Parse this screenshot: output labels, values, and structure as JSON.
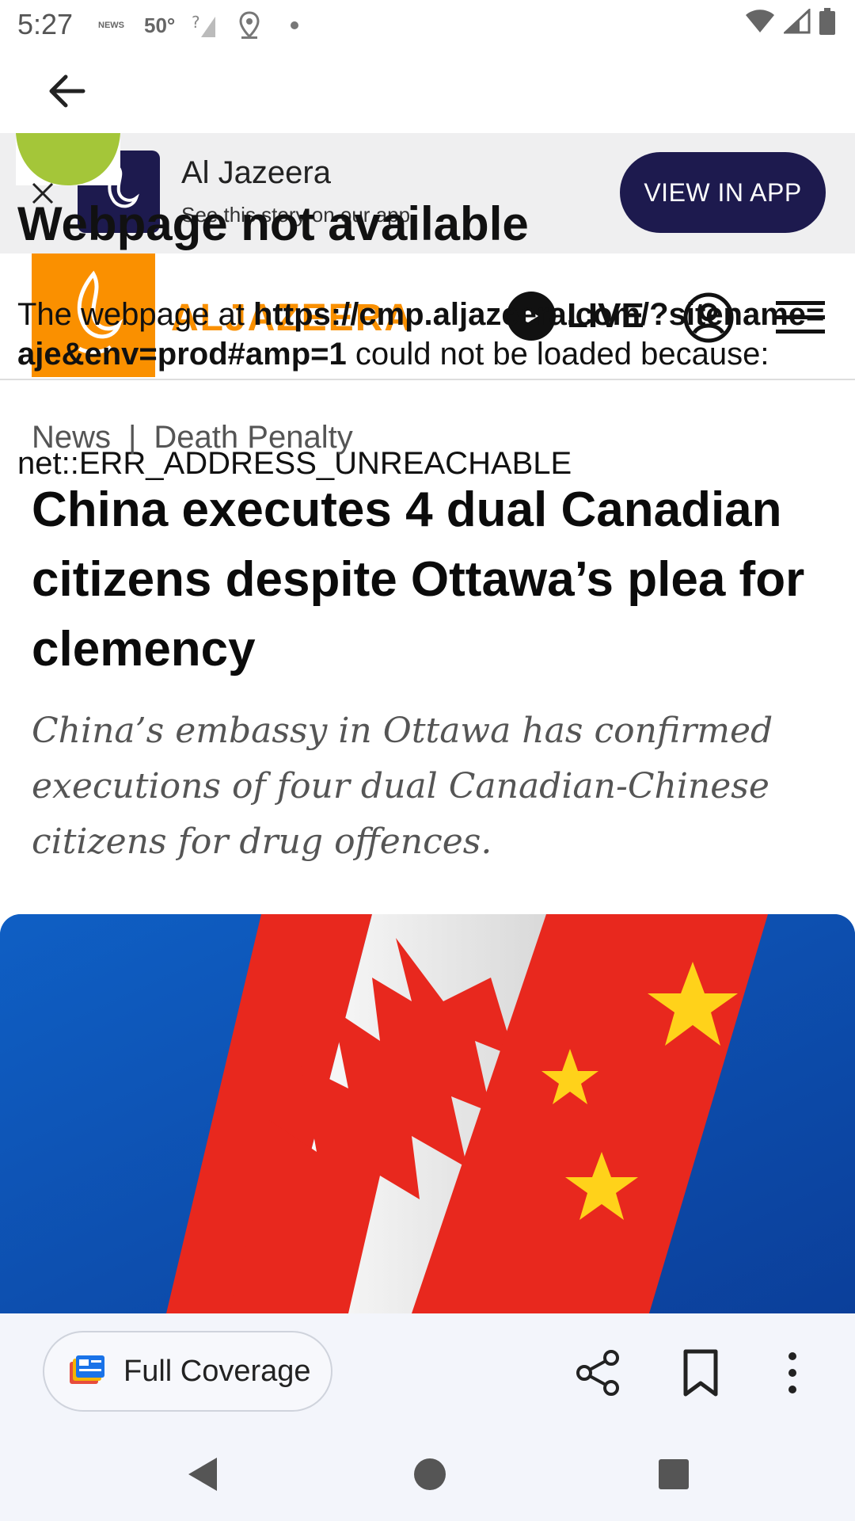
{
  "status_bar": {
    "time": "5:27",
    "temp": "50°",
    "news_label": "NEWS"
  },
  "banner": {
    "title": "Al Jazeera",
    "subtitle": "See this story on our app",
    "view_in_app": "VIEW IN APP"
  },
  "site": {
    "wordmark": "ALJAZEERA",
    "live_label": "LIVE"
  },
  "error": {
    "title": "Webpage not available",
    "body_prefix": "The webpage at ",
    "url": "https://cmp.aljazeera.com/?sitename=aje&env=prod#amp=1",
    "body_suffix": " could not be loaded because:",
    "code": "net::ERR_ADDRESS_UNREACHABLE"
  },
  "article": {
    "breadcrumb": [
      "News",
      "|",
      "Death Penalty"
    ],
    "headline": "China executes 4 dual Canadian citizens despite Ottawa’s plea for clemency",
    "standfirst": "China’s embassy in Ottawa has confirmed executions of four dual Canadian-Chinese citizens for drug offences."
  },
  "actions": {
    "full_coverage": "Full Coverage"
  },
  "colors": {
    "brand_orange": "#fa9000",
    "banner_navy": "#1d1a4e",
    "action_bar_bg": "#f3f5fb"
  }
}
